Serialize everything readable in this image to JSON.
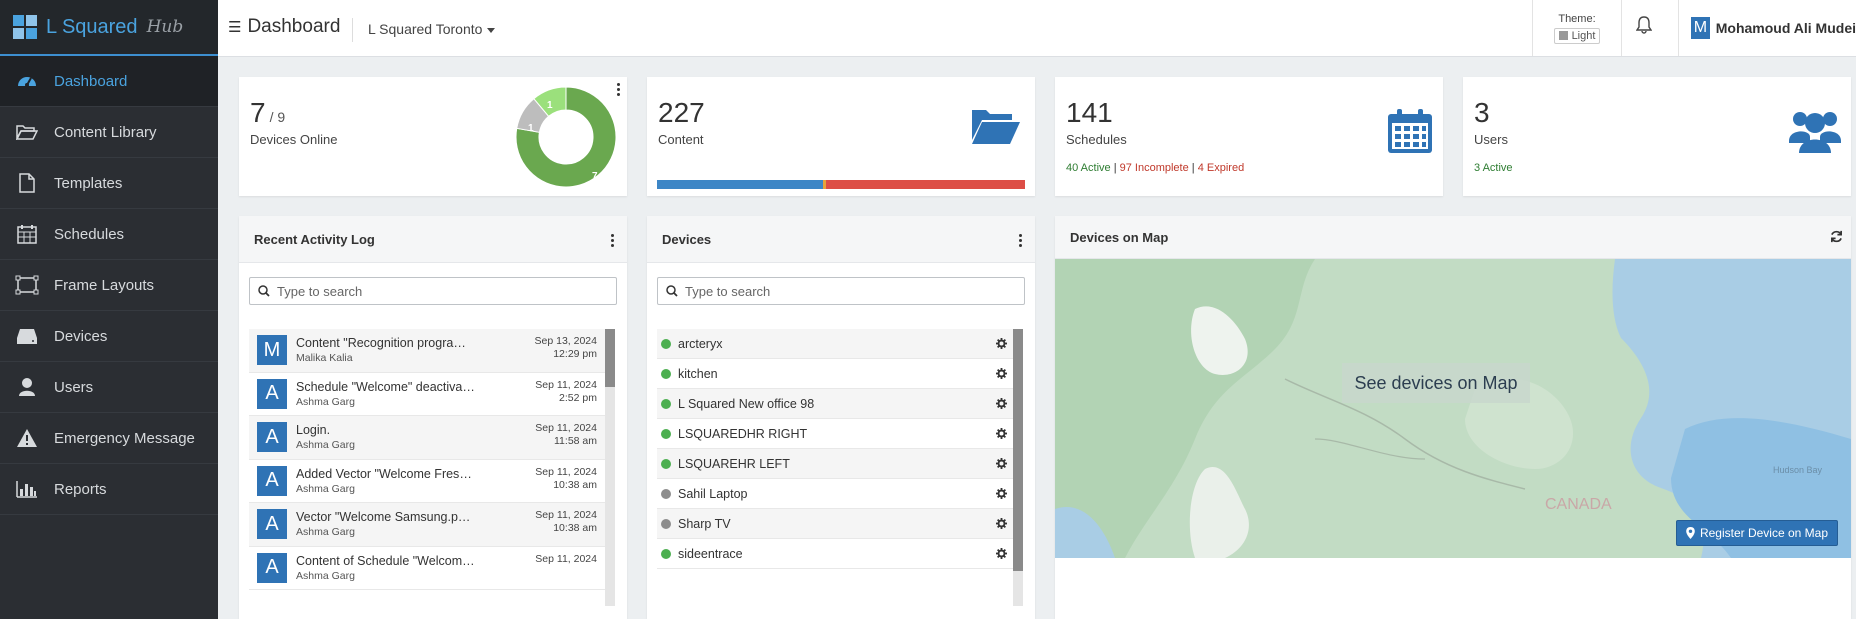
{
  "brand": {
    "name": "L Squared",
    "sub": "Hub"
  },
  "sidebar": {
    "items": [
      {
        "label": "Dashboard",
        "icon": "gauge-icon",
        "active": true
      },
      {
        "label": "Content Library",
        "icon": "folder-open-icon"
      },
      {
        "label": "Templates",
        "icon": "file-icon"
      },
      {
        "label": "Schedules",
        "icon": "calendar-icon"
      },
      {
        "label": "Frame Layouts",
        "icon": "frame-layout-icon"
      },
      {
        "label": "Devices",
        "icon": "hard-drive-icon"
      },
      {
        "label": "Users",
        "icon": "user-icon"
      },
      {
        "label": "Emergency Message",
        "icon": "warning-icon"
      },
      {
        "label": "Reports",
        "icon": "bar-chart-icon"
      }
    ]
  },
  "topbar": {
    "title": "Dashboard",
    "organization": "L Squared Toronto",
    "theme_label": "Theme:",
    "theme_value": "Light",
    "user_initial": "M",
    "user_name": "Mohamoud Ali Mudei"
  },
  "stats": {
    "devices": {
      "online": "7",
      "total": "/ 9",
      "label": "Devices Online",
      "donut": {
        "online": 7,
        "unknown": 1,
        "other": 1
      }
    },
    "content": {
      "count": "227",
      "label": "Content",
      "bar": {
        "blue": 0.45,
        "orange": 0.01,
        "red": 0.54
      }
    },
    "schedules": {
      "count": "141",
      "label": "Schedules",
      "active": "40 Active",
      "sep1": " | ",
      "incomplete": "97 Incomplete",
      "sep2": " | ",
      "expired": "4 Expired"
    },
    "users": {
      "count": "3",
      "label": "Users",
      "active": "3 Active"
    }
  },
  "activity": {
    "title": "Recent Activity Log",
    "search_placeholder": "Type to search",
    "rows": [
      {
        "initial": "M",
        "title": "Content \"Recognition program....",
        "user": "Malika Kalia",
        "date": "Sep 13, 2024",
        "time": "12:29 pm"
      },
      {
        "initial": "A",
        "title": "Schedule \"Welcome\" deactivated",
        "user": "Ashma Garg",
        "date": "Sep 11, 2024",
        "time": "2:52 pm"
      },
      {
        "initial": "A",
        "title": "Login.",
        "user": "Ashma Garg",
        "date": "Sep 11, 2024",
        "time": "11:58 am"
      },
      {
        "initial": "A",
        "title": "Added Vector \"Welcome Freshl...",
        "user": "Ashma Garg",
        "date": "Sep 11, 2024",
        "time": "10:38 am"
      },
      {
        "initial": "A",
        "title": "Vector \"Welcome Samsung.pdf...",
        "user": "Ashma Garg",
        "date": "Sep 11, 2024",
        "time": "10:38 am"
      },
      {
        "initial": "A",
        "title": "Content of Schedule \"Welcome...",
        "user": "Ashma Garg",
        "date": "Sep 11, 2024",
        "time": ""
      }
    ]
  },
  "devices": {
    "title": "Devices",
    "search_placeholder": "Type to search",
    "rows": [
      {
        "name": "arcteryx",
        "status": "online"
      },
      {
        "name": "kitchen",
        "status": "online"
      },
      {
        "name": "L Squared New office 98",
        "status": "online"
      },
      {
        "name": "LSQUAREDHR RIGHT",
        "status": "online"
      },
      {
        "name": "LSQUAREHR LEFT",
        "status": "online"
      },
      {
        "name": "Sahil Laptop",
        "status": "offline"
      },
      {
        "name": "Sharp TV",
        "status": "offline"
      },
      {
        "name": "sideentrace",
        "status": "online"
      }
    ]
  },
  "map": {
    "title": "Devices on Map",
    "button": "See devices on Map",
    "register": "Register Device on Map",
    "labels": [
      "CANADA",
      "Hudson Bay"
    ]
  },
  "colors": {
    "accent": "#2f73b5",
    "online": "#4caf50",
    "offline": "#8d8d8d",
    "active_text": "#2e7d32",
    "incomplete_text": "#c0392b",
    "donut_green": "#6aa84f",
    "donut_light": "#9be07c",
    "donut_grey": "#bdbdbd"
  }
}
